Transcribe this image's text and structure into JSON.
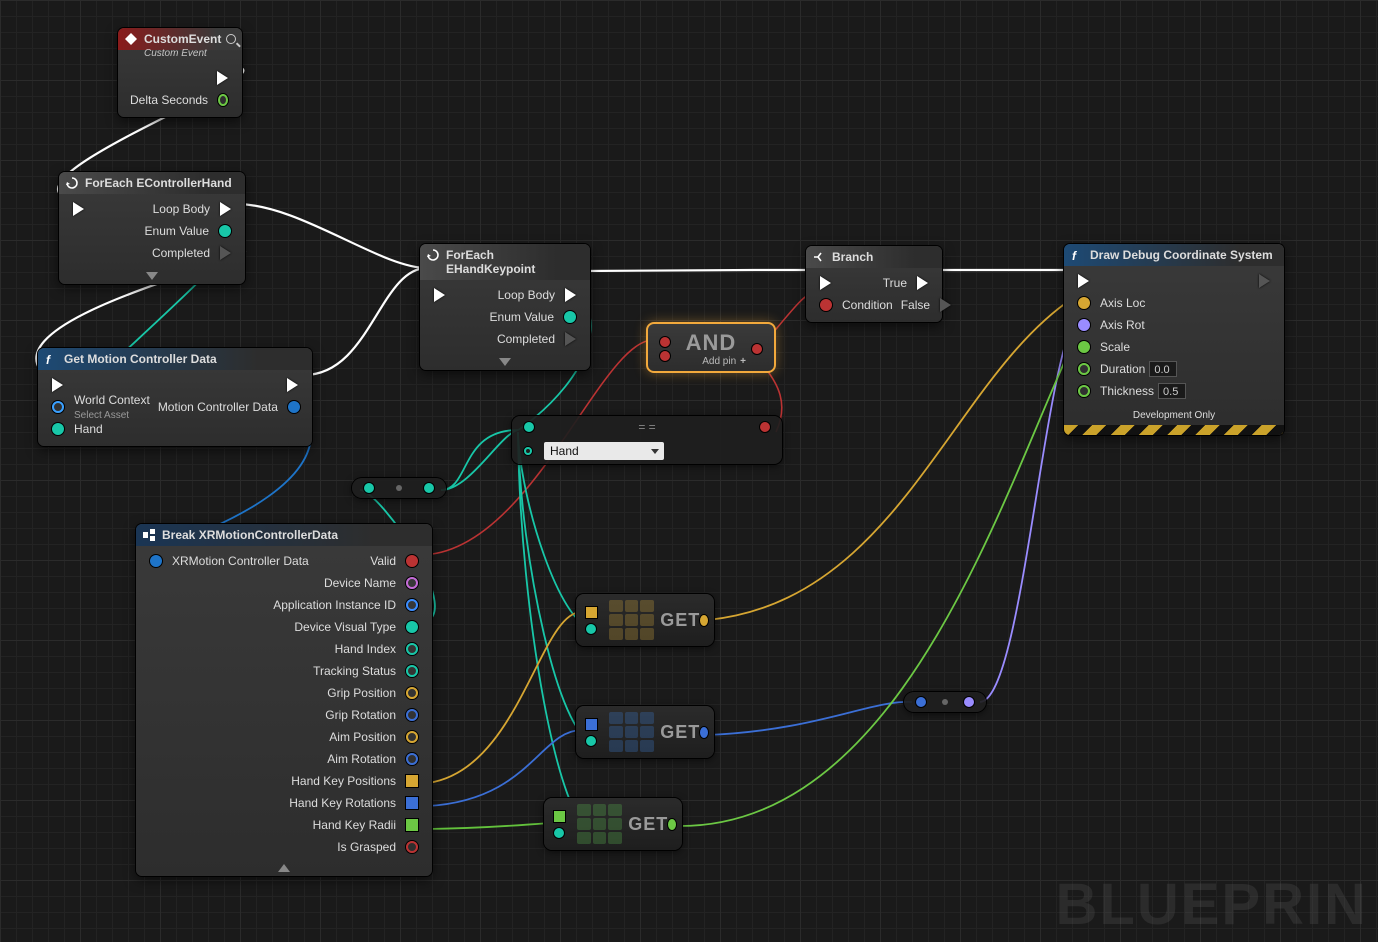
{
  "watermark": "BLUEPRIN",
  "nodes": {
    "custom_event": {
      "title": "CustomEvent",
      "subtitle": "Custom Event",
      "outputs": {
        "exec": "",
        "delta": "Delta Seconds"
      }
    },
    "foreach_hand": {
      "title": "ForEach EControllerHand",
      "outputs": {
        "loop": "Loop Body",
        "enum": "Enum Value",
        "completed": "Completed"
      }
    },
    "get_motion": {
      "title": "Get Motion Controller Data",
      "inputs": {
        "world": "World Context",
        "asset_hint": "Select Asset",
        "hand": "Hand"
      },
      "outputs": {
        "data": "Motion Controller Data"
      }
    },
    "foreach_keypoint": {
      "title": "ForEach EHandKeypoint",
      "outputs": {
        "loop": "Loop Body",
        "enum": "Enum Value",
        "completed": "Completed"
      }
    },
    "branch": {
      "title": "Branch",
      "inputs": {
        "cond": "Condition"
      },
      "outputs": {
        "t": "True",
        "f": "False"
      }
    },
    "and": {
      "label": "AND",
      "addpin": "Add pin"
    },
    "equals": {
      "selected": "Hand"
    },
    "break": {
      "title": "Break XRMotionControllerData",
      "input": "XRMotion Controller Data",
      "outputs": [
        "Valid",
        "Device Name",
        "Application Instance ID",
        "Device Visual Type",
        "Hand Index",
        "Tracking Status",
        "Grip Position",
        "Grip Rotation",
        "Aim Position",
        "Aim Rotation",
        "Hand Key Positions",
        "Hand Key Rotations",
        "Hand Key Radii",
        "Is Grasped"
      ]
    },
    "get": {
      "label": "GET"
    },
    "draw": {
      "title": "Draw Debug Coordinate System",
      "inputs": {
        "loc": "Axis Loc",
        "rot": "Axis Rot",
        "scale": "Scale",
        "duration": "Duration",
        "thickness": "Thickness"
      },
      "duration_val": "0.0",
      "thickness_val": "0.5",
      "footer": "Development Only"
    }
  }
}
